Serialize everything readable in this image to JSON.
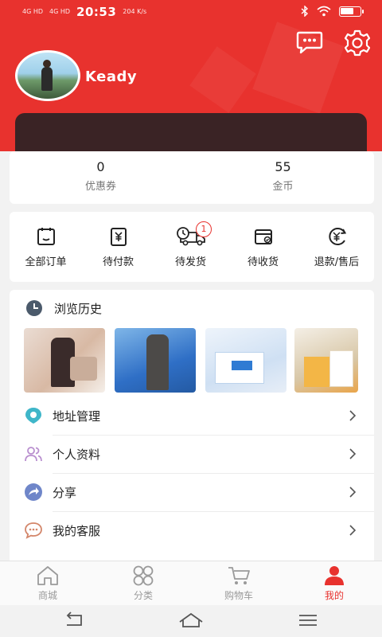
{
  "status_bar": {
    "signal1": "4G HD",
    "signal2": "4G HD",
    "time": "20:53",
    "net_speed": "204 K/s",
    "battery_level": 0.7
  },
  "profile": {
    "username": "Keady"
  },
  "stats": [
    {
      "value": "0",
      "label": "优惠券"
    },
    {
      "value": "55",
      "label": "金币"
    }
  ],
  "orders": [
    {
      "label": "全部订单",
      "icon": "clipboard-icon"
    },
    {
      "label": "待付款",
      "icon": "yuan-bill-icon"
    },
    {
      "label": "待发货",
      "icon": "truck-icon",
      "badge": "1"
    },
    {
      "label": "待收货",
      "icon": "wallet-icon"
    },
    {
      "label": "退款/售后",
      "icon": "refund-icon"
    }
  ],
  "history": {
    "title": "浏览历史"
  },
  "menu": [
    {
      "label": "地址管理",
      "icon": "location-icon"
    },
    {
      "label": "个人资料",
      "icon": "users-icon"
    },
    {
      "label": "分享",
      "icon": "share-icon"
    },
    {
      "label": "我的客服",
      "icon": "chat-icon"
    }
  ],
  "tabs": [
    {
      "label": "商城",
      "icon": "home-icon"
    },
    {
      "label": "分类",
      "icon": "category-icon"
    },
    {
      "label": "购物车",
      "icon": "cart-icon"
    },
    {
      "label": "我的",
      "icon": "person-icon",
      "active": true
    }
  ],
  "colors": {
    "brand": "#e8322e",
    "text": "#222222",
    "muted": "#9a9a9a"
  }
}
